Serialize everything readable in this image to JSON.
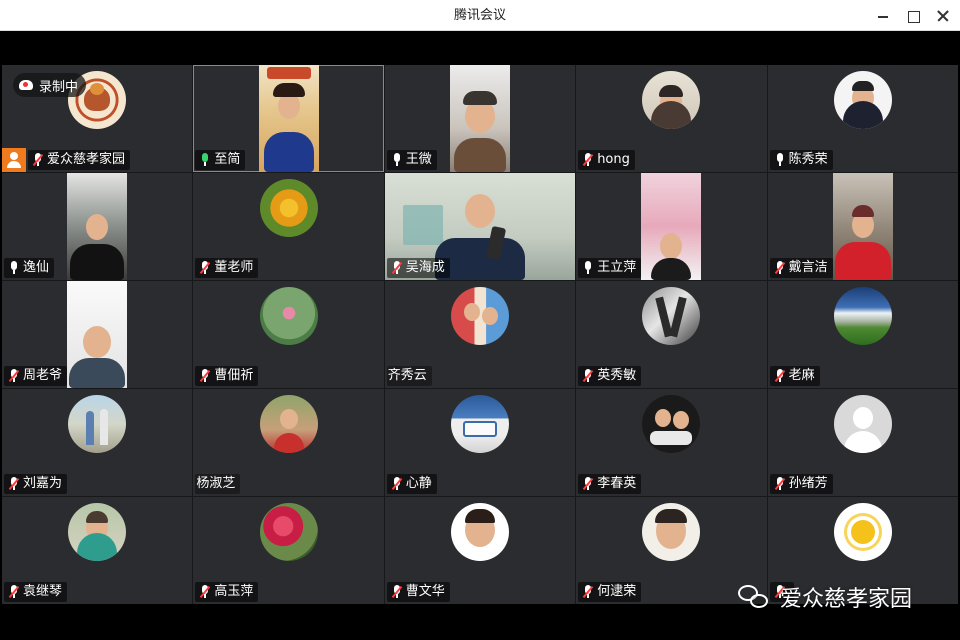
{
  "window": {
    "title": "腾讯会议"
  },
  "recording": {
    "label": "录制中"
  },
  "watermark": {
    "text": "爱众慈孝家园"
  },
  "participants": [
    {
      "name": "爱众慈孝家园",
      "mic": "muted",
      "host": true
    },
    {
      "name": "至简",
      "mic": "active",
      "speaking": true
    },
    {
      "name": "王微",
      "mic": "on"
    },
    {
      "name": "hong",
      "mic": "muted"
    },
    {
      "name": "陈秀荣",
      "mic": "on"
    },
    {
      "name": "逸仙",
      "mic": "on"
    },
    {
      "name": "董老师",
      "mic": "muted"
    },
    {
      "name": "吴海成",
      "mic": "muted"
    },
    {
      "name": "王立萍",
      "mic": "on"
    },
    {
      "name": "戴言洁",
      "mic": "muted"
    },
    {
      "name": "周老爷",
      "mic": "muted"
    },
    {
      "name": "曹佃祈",
      "mic": "muted"
    },
    {
      "name": "齐秀云",
      "mic": "none"
    },
    {
      "name": "英秀敏",
      "mic": "muted"
    },
    {
      "name": "老麻",
      "mic": "muted"
    },
    {
      "name": "刘嘉为",
      "mic": "muted"
    },
    {
      "name": "杨淑芝",
      "mic": "none"
    },
    {
      "name": "心静",
      "mic": "muted"
    },
    {
      "name": "李春英",
      "mic": "muted"
    },
    {
      "name": "孙绪芳",
      "mic": "muted"
    },
    {
      "name": "袁继琴",
      "mic": "muted"
    },
    {
      "name": "高玉萍",
      "mic": "muted"
    },
    {
      "name": "曹文华",
      "mic": "muted"
    },
    {
      "name": "何逮荣",
      "mic": "muted"
    },
    {
      "name": "",
      "mic": "muted"
    }
  ],
  "colors": {
    "tile_bg": "#2b2c2f",
    "speaking_border": "#2fbf68",
    "host_badge": "#f07a1e",
    "muted": "#ff3b3b"
  }
}
